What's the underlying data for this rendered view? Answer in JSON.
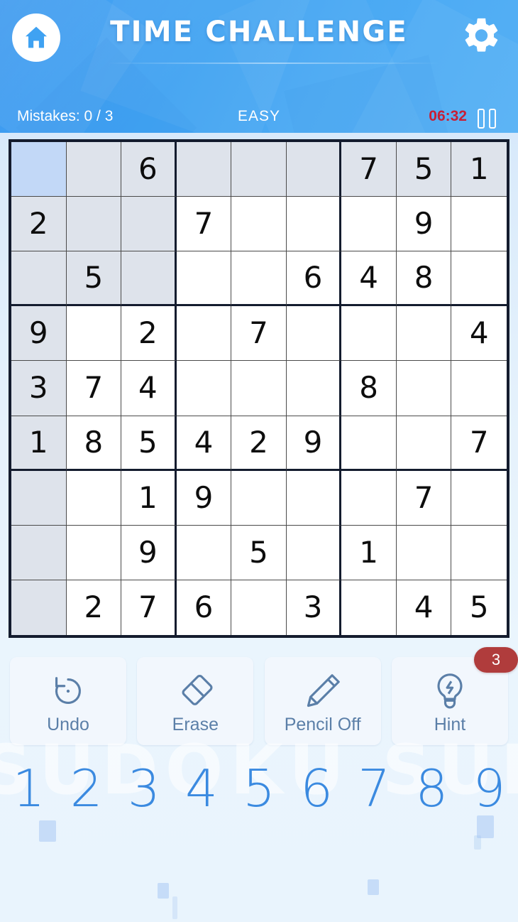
{
  "header": {
    "title": "TIME CHALLENGE",
    "home_icon": "home-icon",
    "settings_icon": "gear-icon"
  },
  "status": {
    "mistakes": "Mistakes: 0 / 3",
    "difficulty": "EASY",
    "timer": "06:32",
    "timer_color": "#c81f35",
    "pause_icon": "pause-icon"
  },
  "board": {
    "selected": {
      "row": 0,
      "col": 0
    },
    "highlight_color": "#dee3eb",
    "selected_color": "#c2d8f7",
    "grid": [
      [
        "",
        "",
        "6",
        "",
        "",
        "",
        "7",
        "5",
        "1"
      ],
      [
        "2",
        "",
        "",
        "7",
        "",
        "",
        "",
        "9",
        ""
      ],
      [
        "",
        "5",
        "",
        "",
        "",
        "6",
        "4",
        "8",
        ""
      ],
      [
        "9",
        "",
        "2",
        "",
        "7",
        "",
        "",
        "",
        "4"
      ],
      [
        "3",
        "7",
        "4",
        "",
        "",
        "",
        "8",
        "",
        ""
      ],
      [
        "1",
        "8",
        "5",
        "4",
        "2",
        "9",
        "",
        "",
        "7"
      ],
      [
        "",
        "",
        "1",
        "9",
        "",
        "",
        "",
        "7",
        ""
      ],
      [
        "",
        "",
        "9",
        "",
        "5",
        "",
        "1",
        "",
        ""
      ],
      [
        "",
        "2",
        "7",
        "6",
        "",
        "3",
        "",
        "4",
        "5"
      ]
    ],
    "highlight_cells": [
      [
        0,
        0
      ],
      [
        0,
        1
      ],
      [
        0,
        2
      ],
      [
        0,
        3
      ],
      [
        0,
        4
      ],
      [
        0,
        5
      ],
      [
        0,
        6
      ],
      [
        0,
        7
      ],
      [
        0,
        8
      ],
      [
        1,
        0
      ],
      [
        1,
        1
      ],
      [
        1,
        2
      ],
      [
        2,
        0
      ],
      [
        2,
        1
      ],
      [
        2,
        2
      ],
      [
        3,
        0
      ],
      [
        4,
        0
      ],
      [
        5,
        0
      ],
      [
        6,
        0
      ],
      [
        7,
        0
      ],
      [
        8,
        0
      ]
    ]
  },
  "actions": [
    {
      "label": "Undo",
      "icon": "undo-icon"
    },
    {
      "label": "Erase",
      "icon": "eraser-icon"
    },
    {
      "label": "Pencil Off",
      "icon": "pencil-icon"
    },
    {
      "label": "Hint",
      "icon": "lightbulb-icon",
      "badge": "3",
      "badge_color": "#b03c3c"
    }
  ],
  "numpad": [
    "1",
    "2",
    "3",
    "4",
    "5",
    "6",
    "7",
    "8",
    "9"
  ],
  "watermark": "SUDOKU SUDOKU",
  "accent_color": "#3b8ae0"
}
